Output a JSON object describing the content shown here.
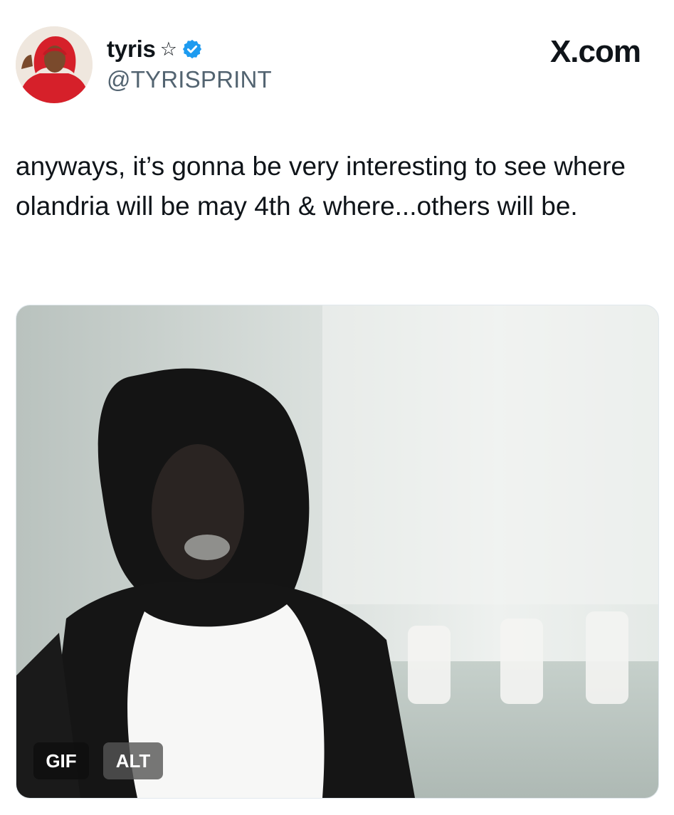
{
  "post": {
    "display_name": "tyris",
    "name_symbol": "☆",
    "handle": "@TYRISPRINT",
    "verified": true,
    "brand": "X.com",
    "text": "anyways, it’s gonna be very interesting to see where olandria will be may 4th & where...others will be.",
    "media": {
      "gif_badge": "GIF",
      "alt_badge": "ALT"
    }
  },
  "colors": {
    "text": "#0f1419",
    "secondary": "#536471",
    "verified": "#1d9bf0",
    "avatar_hoodie": "#d6202a"
  },
  "icons": {
    "verified": "verified-badge-icon",
    "star": "star-outline-icon"
  }
}
